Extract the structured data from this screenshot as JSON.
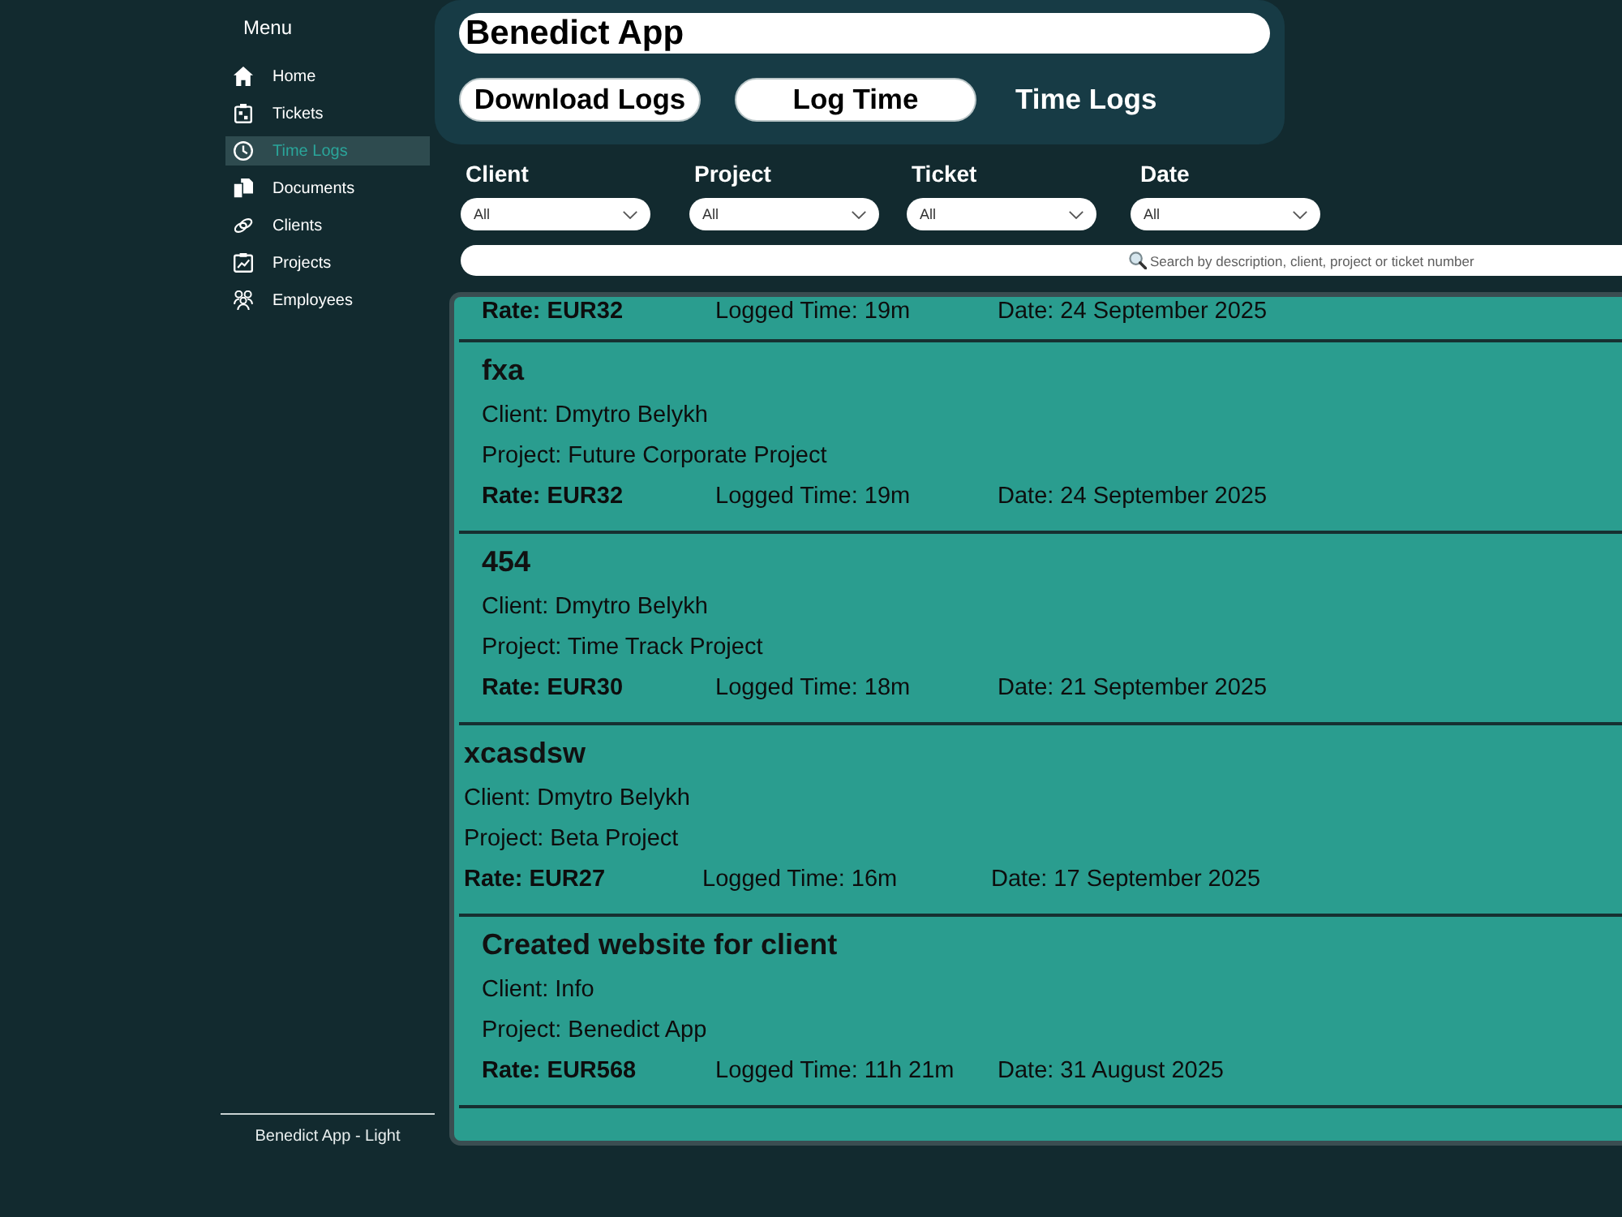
{
  "sidebar": {
    "title": "Menu",
    "items": [
      {
        "label": "Home",
        "selected": false
      },
      {
        "label": "Tickets",
        "selected": false
      },
      {
        "label": "Time Logs",
        "selected": true
      },
      {
        "label": "Documents",
        "selected": false
      },
      {
        "label": "Clients",
        "selected": false
      },
      {
        "label": "Projects",
        "selected": false
      },
      {
        "label": "Employees",
        "selected": false
      }
    ],
    "footer": "Benedict App - Light"
  },
  "header": {
    "title": "Benedict App",
    "buttons": [
      "Download Logs",
      "Log Time"
    ],
    "page_title": "Time Logs"
  },
  "filters": [
    {
      "label": "Client",
      "value": "All"
    },
    {
      "label": "Project",
      "value": "All"
    },
    {
      "label": "Ticket",
      "value": "All"
    },
    {
      "label": "Date",
      "value": "All"
    }
  ],
  "search": {
    "placeholder": "Search by description, client, project or ticket number"
  },
  "time_logs": [
    {
      "rate": "Rate: EUR32",
      "logged_time": "Logged Time: 19m",
      "date": "Date: 24 September 2025"
    },
    {
      "title": "fxa",
      "client": "Client: Dmytro Belykh",
      "project": "Project: Future Corporate Project",
      "rate": "Rate: EUR32",
      "logged_time": "Logged Time: 19m",
      "date": "Date: 24 September 2025"
    },
    {
      "title": "454",
      "client": "Client: Dmytro Belykh",
      "project": "Project: Time Track Project",
      "rate": "Rate: EUR30",
      "logged_time": "Logged Time: 18m",
      "date": "Date: 21 September 2025"
    },
    {
      "title": "xcasdsw",
      "client": "Client: Dmytro Belykh",
      "project": "Project: Beta Project",
      "rate": "Rate: EUR27",
      "logged_time": "Logged Time: 16m",
      "date": "Date: 17 September 2025"
    },
    {
      "title": "Created website for client",
      "client": "Client: Info",
      "project": "Project: Benedict App",
      "rate": "Rate: EUR568",
      "logged_time": "Logged Time: 11h 21m",
      "date": "Date: 31 August 2025"
    }
  ]
}
